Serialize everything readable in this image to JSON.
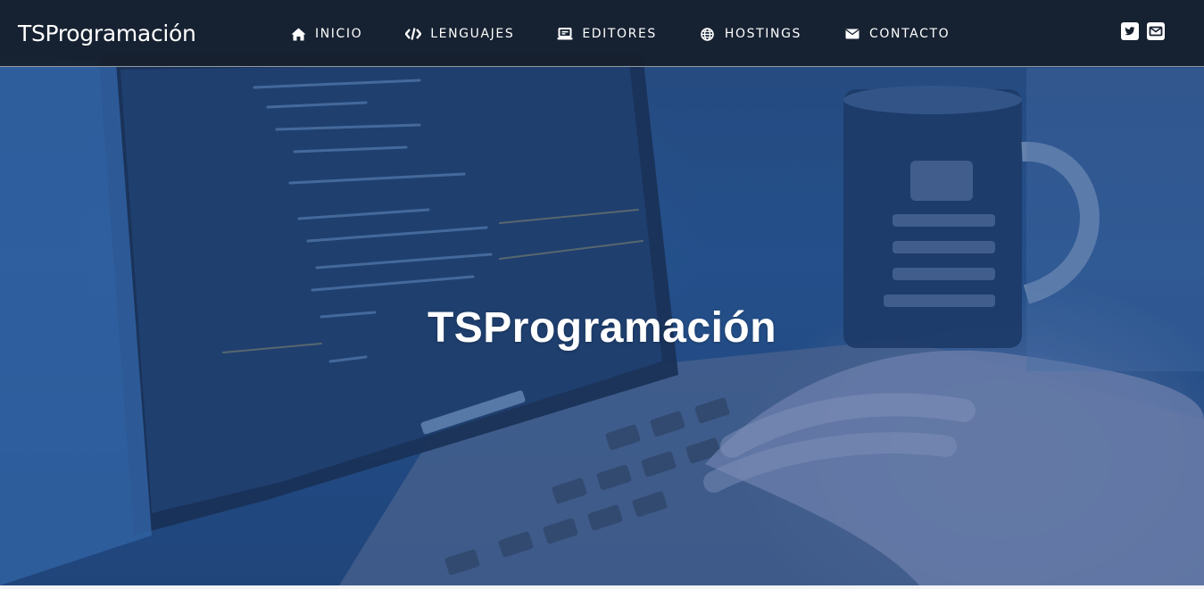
{
  "navbar": {
    "brand": "TSProgramación",
    "items": [
      {
        "label": "INICIO",
        "icon": "home-icon"
      },
      {
        "label": "LENGUAJES",
        "icon": "code-icon"
      },
      {
        "label": "EDITORES",
        "icon": "laptop-icon"
      },
      {
        "label": "HOSTINGS",
        "icon": "globe-icon"
      },
      {
        "label": "CONTACTO",
        "icon": "envelope-icon"
      }
    ],
    "social": [
      {
        "icon": "twitter-icon"
      },
      {
        "icon": "envelope-square-icon"
      }
    ]
  },
  "hero": {
    "title": "TSProgramación"
  },
  "colors": {
    "navbar_bg": "#161f2e",
    "hero_tint": "#2a5690",
    "text": "#ffffff"
  }
}
